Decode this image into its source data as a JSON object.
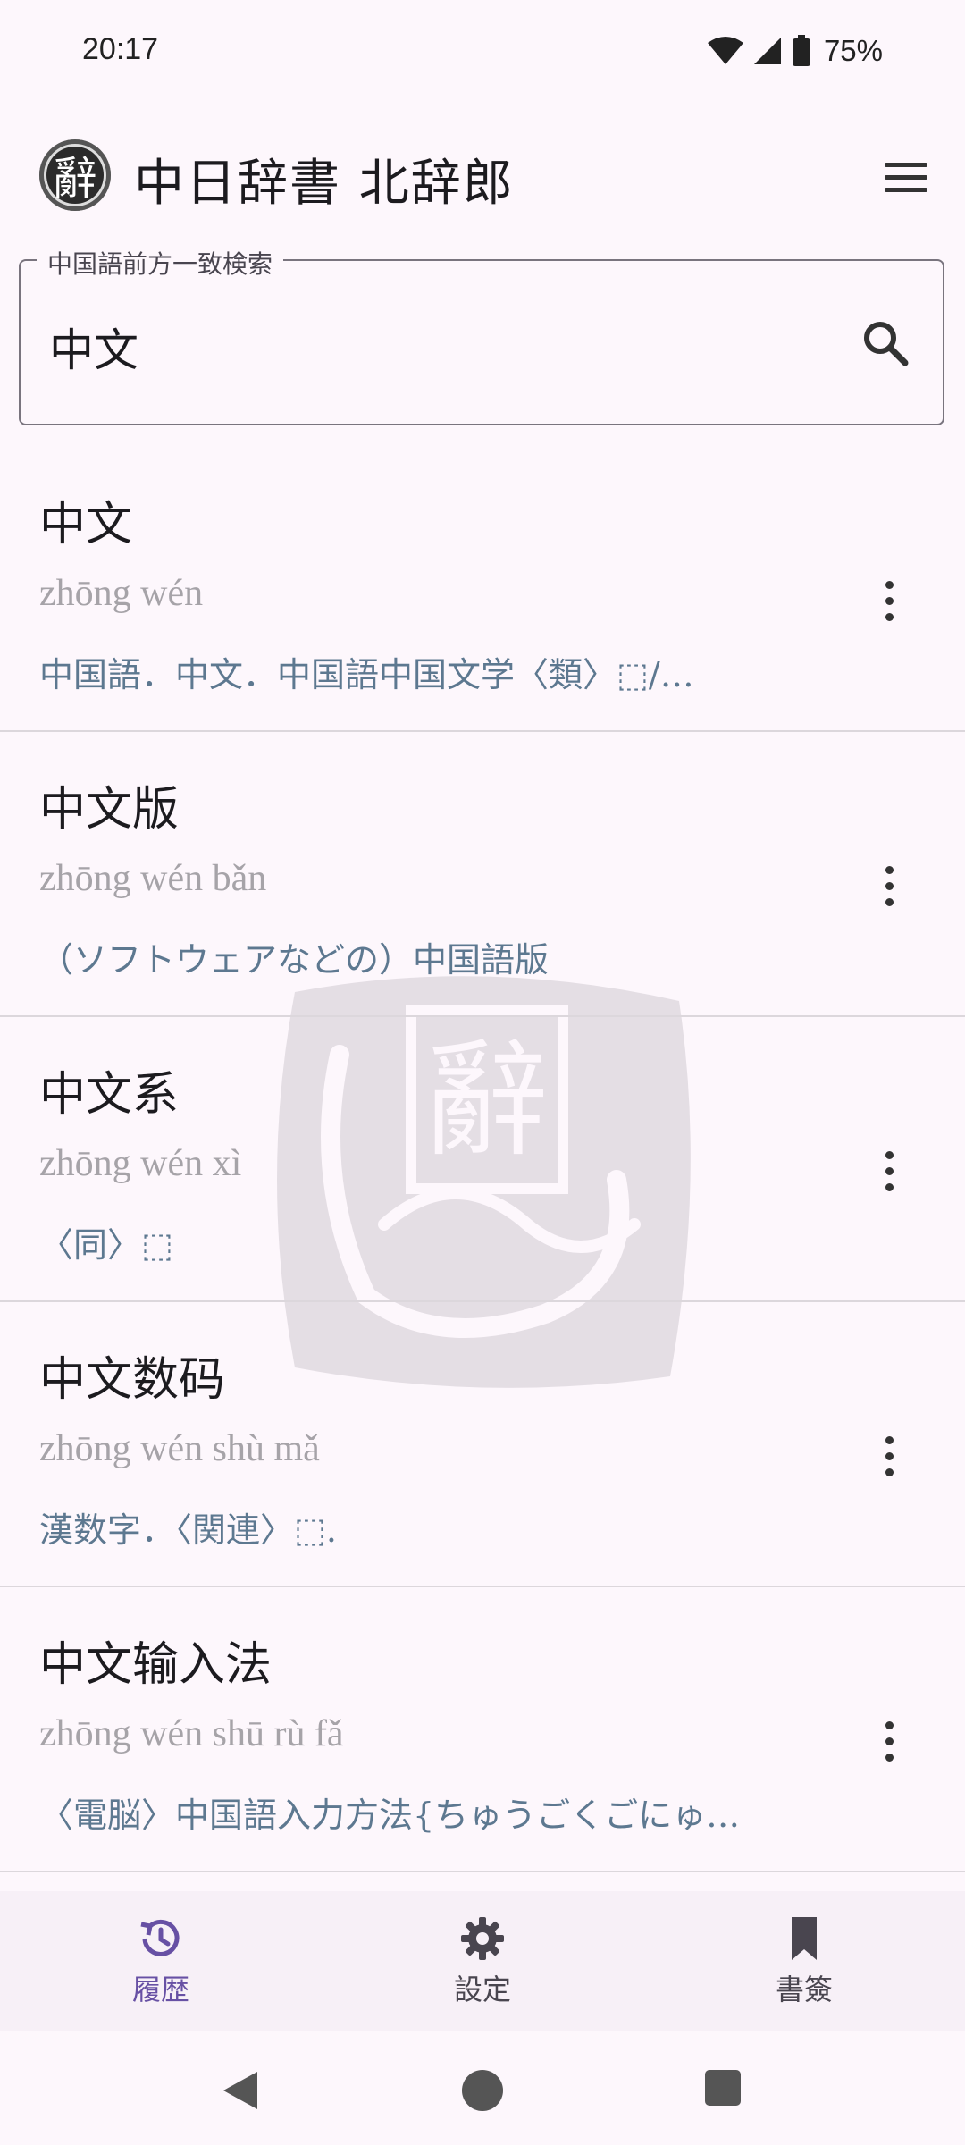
{
  "status": {
    "time": "20:17",
    "battery": "75%"
  },
  "app": {
    "title": "中日辞書 北辞郎",
    "logo_char": "辭"
  },
  "search": {
    "label": "中国語前方一致検索",
    "value": "中文"
  },
  "results": [
    {
      "word": "中文",
      "pinyin": "zhōng wén",
      "definition": "中国語．中文．中国語中国文学〈類〉⬚/…"
    },
    {
      "word": "中文版",
      "pinyin": "zhōng wén bǎn",
      "definition": "（ソフトウェアなどの）中国語版"
    },
    {
      "word": "中文系",
      "pinyin": "zhōng wén xì",
      "definition": "〈同〉⬚"
    },
    {
      "word": "中文数码",
      "pinyin": "zhōng wén shù mǎ",
      "definition": "漢数字．〈関連〉⬚."
    },
    {
      "word": "中文输入法",
      "pinyin": "zhōng wén shū rù fǎ",
      "definition": "〈電脳〉中国語入力方法{ちゅうごくごにゅ…"
    }
  ],
  "nav": {
    "history": "履歴",
    "settings": "設定",
    "bookmarks": "書簽"
  },
  "colors": {
    "accent": "#6750a4",
    "definition": "#5d7890",
    "pinyin": "#a6a3a8",
    "background": "#fdf7fc"
  }
}
